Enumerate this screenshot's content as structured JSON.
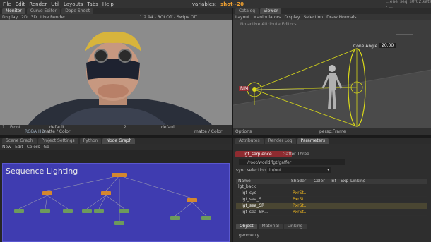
{
  "menubar": {
    "items": [
      "File",
      "Edit",
      "Render",
      "Util",
      "Layouts",
      "Tabs",
      "Help"
    ],
    "variables_label": "variables:",
    "shot_label": "shot~20",
    "window_title": "...ene_seq_s0f02.katana - ..."
  },
  "monitor": {
    "tabs": [
      "Monitor",
      "Curve Editor",
      "Dope Sheet"
    ],
    "toolbar": [
      "Display",
      "2D",
      "3D",
      "Live Render"
    ],
    "status": [
      "1:2.94 - ROI Off - Swipe Off"
    ],
    "footer_left": [
      "Front",
      "RGBA HD"
    ],
    "footer_vals": [
      "default",
      "default",
      "matte / Color",
      "matte / Color"
    ],
    "frame_a": "1",
    "frame_b": "2"
  },
  "viewer": {
    "tabs": [
      "Catalog",
      "Viewer"
    ],
    "menu": [
      "Layout",
      "Manipulators",
      "Display",
      "Selection",
      "Draw Normals"
    ],
    "manip_label": "No active Attribute Editors",
    "cone_angle_label": "Cone Angle",
    "cone_angle_value": "20.00",
    "rim_label": "RIM",
    "footer_left": "Options",
    "footer_cam": "persp:Frame"
  },
  "nodegraph": {
    "tabs": [
      "Scene Graph",
      "Project Settings",
      "Python",
      "Node Graph"
    ],
    "menu": [
      "New",
      "Edit",
      "Colors",
      "Go"
    ],
    "backdrop_title": "Sequence Lighting"
  },
  "params": {
    "tabs": [
      "Attributes",
      "Render Log",
      "Parameters"
    ],
    "node_name": "lgt_sequence",
    "node_type": "Gaffer Three",
    "path": "/root/world/lgt/gaffer",
    "sync_label": "sync selection",
    "sync_value": "in/out",
    "columns": [
      "Name",
      "Shader",
      "Color",
      "Int",
      "Exp",
      "Linking"
    ],
    "rows": [
      {
        "name": "lgt_back",
        "shader": ""
      },
      {
        "name": "lgt_cyc",
        "shader": "PxrSt..."
      },
      {
        "name": "lgt_sea_S...",
        "shader": "PxrSt..."
      },
      {
        "name": "lgt_sea_SR",
        "shader": "PxrSt..."
      },
      {
        "name": "lgt_sea_SR...",
        "shader": "PxrSt..."
      }
    ],
    "bottom_tabs": [
      "Object",
      "Material",
      "Linking"
    ],
    "geometry_label": "geometry"
  },
  "colors": {
    "node_orange": "#d4872f",
    "node_green": "#6d9a5c",
    "backdrop": "#3f3cb0",
    "accent_red": "#8e2b30",
    "light_yellow": "#d8d81a"
  }
}
